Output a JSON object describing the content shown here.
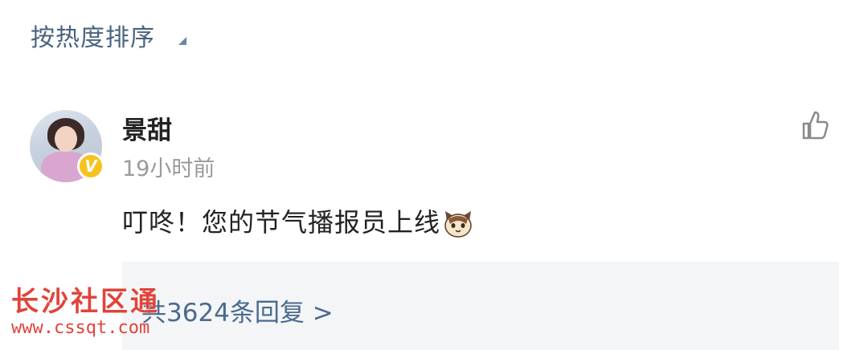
{
  "sort": {
    "label": "按热度排序"
  },
  "comment": {
    "username": "景甜",
    "verified_badge": "V",
    "timestamp": "19小时前",
    "text": "叮咚！您的节气播报员上线",
    "emoji": "cat-emoji",
    "replies_label": "共3624条回复 >"
  },
  "watermark": {
    "title": "长沙社区通",
    "url": "www.cssqt.com"
  },
  "icons": {
    "like": "thumbs-up-icon",
    "caret": "sort-caret-icon"
  },
  "colors": {
    "link": "#4a6a90",
    "badge": "#f7c21d",
    "watermark": "#e0443b"
  }
}
